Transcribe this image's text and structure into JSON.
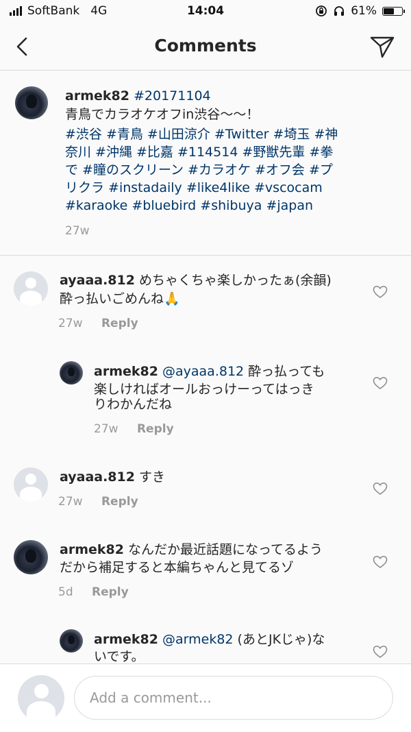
{
  "status_bar": {
    "carrier": "SoftBank",
    "network": "4G",
    "time": "14:04",
    "battery": "61%",
    "battery_level": 0.61
  },
  "header": {
    "title": "Comments",
    "back_icon": "chevron-left-icon",
    "share_icon": "paper-plane-icon"
  },
  "caption": {
    "username": "armek82",
    "first_tag": "#20171104",
    "text": "青鳥でカラオケオフin渋谷〜〜！",
    "hashtag_lines": [
      "#渋谷 #青鳥 #山田涼介 #Twitter #埼玉 #神",
      "奈川 #沖縄 #比嘉 #114514 #野獣先輩 #拳",
      "で #瞳のスクリーン #カラオケ #オフ会 #プ",
      "リクラ #instadaily #like4like #vscocam",
      "#karaoke #bluebird #shibuya #japan"
    ],
    "time": "27w"
  },
  "comments": [
    {
      "username": "ayaaa.812",
      "lines": [
        "めちゃくちゃ楽しかったぁ(余韻)",
        "酔っ払いごめんね🙏"
      ],
      "time": "27w",
      "reply_label": "Reply"
    },
    {
      "username": "armek82",
      "mention": "@ayaaa.812",
      "lines": [
        "酔っ払っても",
        "楽しければオールおっけーってはっき",
        "りわかんだね"
      ],
      "time": "27w",
      "reply_label": "Reply"
    },
    {
      "username": "ayaaa.812",
      "lines": [
        "すき"
      ],
      "time": "27w",
      "reply_label": "Reply"
    },
    {
      "username": "armek82",
      "lines": [
        "なんだか最近話題になってるよう",
        "だから補足すると本編ちゃんと見てるゾ"
      ],
      "time": "5d",
      "reply_label": "Reply"
    },
    {
      "username": "armek82",
      "mention": "@armek82",
      "lines": [
        "(あとJKじゃ)な",
        "いです。"
      ]
    }
  ],
  "composer": {
    "placeholder": "Add a comment..."
  }
}
